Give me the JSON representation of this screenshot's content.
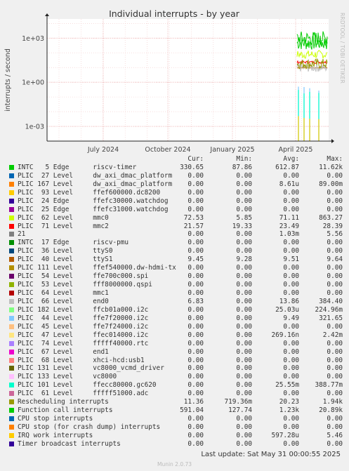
{
  "chart_data": {
    "type": "line",
    "title": "Individual interrupts - by year",
    "ylabel": "interrupts / second",
    "yscale": "log",
    "ylim": [
      0.0001,
      20000
    ],
    "y_ticks": [
      {
        "value": 1000,
        "label": "1e+03"
      },
      {
        "value": 1,
        "label": "1e+00"
      },
      {
        "value": 0.001,
        "label": "1e-03"
      }
    ],
    "x_ticks": [
      "July 2024",
      "October 2024",
      "January 2025",
      "April 2025"
    ],
    "grid": true,
    "side_label": "RRDTOOL / TOBI OETIKER",
    "data_start_position": "late April 2025",
    "columns": [
      "Cur:",
      "Min:",
      "Avg:",
      "Max:"
    ],
    "series": [
      {
        "name": "INTC   5 Edge      riscv-timer",
        "color": "#00cc00",
        "cur": "330.65",
        "min": "87.86",
        "avg": "612.87",
        "max": "11.62k",
        "plot": "band",
        "band_lo": 150,
        "band_hi": 1500
      },
      {
        "name": "PLIC  27 Level     dw_axi_dmac_platform",
        "color": "#0066b3",
        "cur": "0.00",
        "min": "0.00",
        "avg": "0.00",
        "max": "0.00"
      },
      {
        "name": "PLIC 167 Level     dw_axi_dmac_platform",
        "color": "#ff8000",
        "cur": "0.00",
        "min": "0.00",
        "avg": "8.61u",
        "max": "89.00m"
      },
      {
        "name": "PLIC  93 Level     ffef600000.dc8200",
        "color": "#ffcc00",
        "cur": "0.00",
        "min": "0.00",
        "avg": "0.00",
        "max": "0.00"
      },
      {
        "name": "PLIC  24 Edge      ffefc30000.watchdog",
        "color": "#330099",
        "cur": "0.00",
        "min": "0.00",
        "avg": "0.00",
        "max": "0.00"
      },
      {
        "name": "PLIC  25 Edge      ffefc31000.watchdog",
        "color": "#990099",
        "cur": "0.00",
        "min": "0.00",
        "avg": "0.00",
        "max": "0.00"
      },
      {
        "name": "PLIC  62 Level     mmc0",
        "color": "#ccff00",
        "cur": "72.53",
        "min": "5.85",
        "avg": "71.11",
        "max": "863.27",
        "plot": "band",
        "band_lo": 40,
        "band_hi": 150
      },
      {
        "name": "PLIC  71 Level     mmc2",
        "color": "#ff0000",
        "cur": "21.57",
        "min": "19.33",
        "avg": "23.49",
        "max": "28.39",
        "plot": "band",
        "band_lo": 19,
        "band_hi": 28
      },
      {
        "name": "21",
        "color": "#808080",
        "cur": "0.00",
        "min": "0.00",
        "avg": "1.03m",
        "max": "5.56"
      },
      {
        "name": "INTC  17 Edge      riscv-pmu",
        "color": "#008f00",
        "cur": "0.00",
        "min": "0.00",
        "avg": "0.00",
        "max": "0.00"
      },
      {
        "name": "PLIC  36 Level     ttyS0",
        "color": "#00487d",
        "cur": "0.00",
        "min": "0.00",
        "avg": "0.00",
        "max": "0.00"
      },
      {
        "name": "PLIC  40 Level     ttyS1",
        "color": "#b35a00",
        "cur": "9.45",
        "min": "9.28",
        "avg": "9.51",
        "max": "9.64",
        "plot": "band",
        "band_lo": 9.3,
        "band_hi": 9.6
      },
      {
        "name": "PLIC 111 Level     ffef540000.dw-hdmi-tx",
        "color": "#b38f00",
        "cur": "0.00",
        "min": "0.00",
        "avg": "0.00",
        "max": "0.00"
      },
      {
        "name": "PLIC  54 Level     ffe700c000.spi",
        "color": "#6b006b",
        "cur": "0.00",
        "min": "0.00",
        "avg": "0.00",
        "max": "0.00"
      },
      {
        "name": "PLIC  53 Level     fff8000000.qspi",
        "color": "#8fb300",
        "cur": "0.00",
        "min": "0.00",
        "avg": "0.00",
        "max": "0.00"
      },
      {
        "name": "PLIC  64 Level     mmc1",
        "color": "#b30000",
        "cur": "0.00",
        "min": "0.00",
        "avg": "0.00",
        "max": "0.00"
      },
      {
        "name": "PLIC  66 Level     end0",
        "color": "#bebebe",
        "cur": "6.83",
        "min": "0.00",
        "avg": "13.86",
        "max": "384.40",
        "plot": "band",
        "band_lo": 5,
        "band_hi": 20
      },
      {
        "name": "PLIC 182 Level     ffcb01a000.i2c",
        "color": "#80ff80",
        "cur": "0.00",
        "min": "0.00",
        "avg": "25.03u",
        "max": "224.96m"
      },
      {
        "name": "PLIC  44 Level     ffe7f20000.i2c",
        "color": "#80c9ff",
        "cur": "0.00",
        "min": "0.00",
        "avg": "9.49",
        "max": "321.65",
        "plot": "spike",
        "spike_top": 0.5
      },
      {
        "name": "PLIC  45 Level     ffe7f24000.i2c",
        "color": "#ffc080",
        "cur": "0.00",
        "min": "0.00",
        "avg": "0.00",
        "max": "0.00"
      },
      {
        "name": "PLIC  47 Level     ffec014000.i2c",
        "color": "#ffe680",
        "cur": "0.00",
        "min": "0.00",
        "avg": "269.16n",
        "max": "2.42m"
      },
      {
        "name": "PLIC  74 Level     fffff40000.rtc",
        "color": "#aa80ff",
        "cur": "0.00",
        "min": "0.00",
        "avg": "0.00",
        "max": "0.00"
      },
      {
        "name": "PLIC  67 Level     end1",
        "color": "#ee00cc",
        "cur": "0.00",
        "min": "0.00",
        "avg": "0.00",
        "max": "0.00"
      },
      {
        "name": "PLIC  68 Level     xhci-hcd:usb1",
        "color": "#ff8080",
        "cur": "0.00",
        "min": "0.00",
        "avg": "0.00",
        "max": "0.00"
      },
      {
        "name": "PLIC 131 Level     vc8000_vcmd_driver",
        "color": "#666600",
        "cur": "0.00",
        "min": "0.00",
        "avg": "0.00",
        "max": "0.00"
      },
      {
        "name": "PLIC 133 Level     vc8000",
        "color": "#ffbfff",
        "cur": "0.00",
        "min": "0.00",
        "avg": "0.00",
        "max": "0.00"
      },
      {
        "name": "PLIC 101 Level     ffecc80000.gc620",
        "color": "#00ffcc",
        "cur": "0.00",
        "min": "0.00",
        "avg": "25.55m",
        "max": "388.77m",
        "plot": "spike",
        "spike_top": 0.3
      },
      {
        "name": "PLIC  61 Level     fffff51000.adc",
        "color": "#cc6699",
        "cur": "0.00",
        "min": "0.00",
        "avg": "0.00",
        "max": "0.00"
      },
      {
        "name": "Rescheduling interrupts",
        "color": "#999900",
        "cur": "11.36",
        "min": "719.36m",
        "avg": "20.23",
        "max": "1.94k",
        "plot": "band",
        "band_lo": 8,
        "band_hi": 40
      },
      {
        "name": "Function call interrupts",
        "color": "#00cc00",
        "cur": "591.04",
        "min": "127.74",
        "avg": "1.23k",
        "max": "20.89k",
        "plot": "band",
        "band_lo": 300,
        "band_hi": 3000
      },
      {
        "name": "CPU stop interrupts",
        "color": "#0066b3",
        "cur": "0.00",
        "min": "0.00",
        "avg": "0.00",
        "max": "0.00"
      },
      {
        "name": "CPU stop (for crash dump) interrupts",
        "color": "#ff8000",
        "cur": "0.00",
        "min": "0.00",
        "avg": "0.00",
        "max": "0.00"
      },
      {
        "name": "IRQ work interrupts",
        "color": "#ffcc00",
        "cur": "0.00",
        "min": "0.00",
        "avg": "597.28u",
        "max": "5.46",
        "plot": "spike",
        "spike_top": 0.005
      },
      {
        "name": "Timer broadcast interrupts",
        "color": "#330099",
        "cur": "0.00",
        "min": "0.00",
        "avg": "0.00",
        "max": "0.00"
      }
    ]
  },
  "footer": {
    "last_update": "Last update: Sat May 31 00:00:55 2025",
    "munin_version": "Munin 2.0.73"
  }
}
